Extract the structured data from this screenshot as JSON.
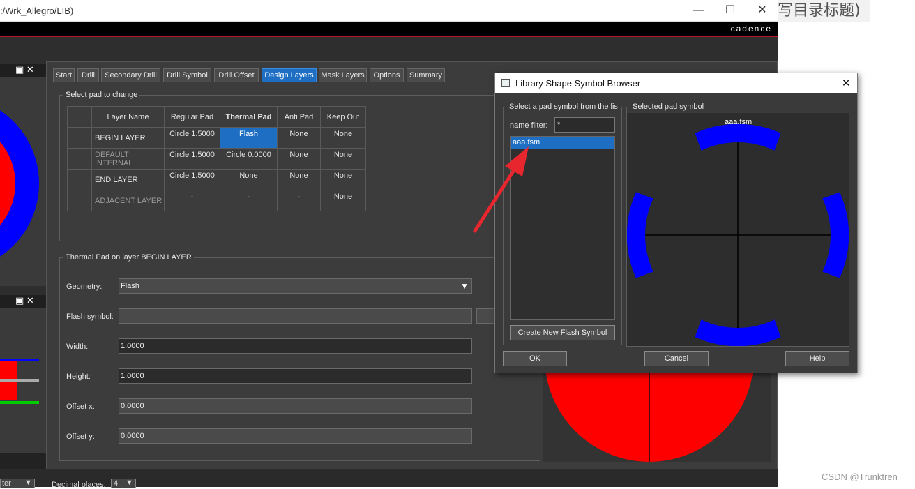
{
  "window": {
    "path": ":/Wrk_Allegro/LIB)",
    "minimize": "—",
    "maximize": "☐",
    "close": "✕",
    "brand": "cadence"
  },
  "blog": {
    "heading_fragment": "写目录标题)",
    "watermark": "CSDN @Trunktren"
  },
  "left_panel": {
    "panel1_buttons": "▣ ✕",
    "panel2_buttons": "▣ ✕"
  },
  "tabs": [
    "Start",
    "Drill",
    "Secondary Drill",
    "Drill Symbol",
    "Drill Offset",
    "Design Layers",
    "Mask Layers",
    "Options",
    "Summary"
  ],
  "active_tab": "Design Layers",
  "select_pad": {
    "group_title": "Select pad to change",
    "columns": [
      "Layer Name",
      "Regular Pad",
      "Thermal Pad",
      "Anti Pad",
      "Keep Out"
    ],
    "rows": [
      {
        "layer": "BEGIN LAYER",
        "regular": "Circle 1.5000",
        "thermal": "Flash",
        "anti": "None",
        "keepout": "None"
      },
      {
        "layer": "DEFAULT INTERNAL",
        "regular": "Circle 1.5000",
        "thermal": "Circle 0.0000",
        "anti": "None",
        "keepout": "None"
      },
      {
        "layer": "END LAYER",
        "regular": "Circle 1.5000",
        "thermal": "None",
        "anti": "None",
        "keepout": "None"
      },
      {
        "layer": "ADJACENT LAYER",
        "regular": "-",
        "thermal": "-",
        "anti": "-",
        "keepout": "None"
      }
    ]
  },
  "thermal": {
    "group_title": "Thermal Pad on layer BEGIN LAYER",
    "geometry_label": "Geometry:",
    "geometry_value": "Flash",
    "flash_label": "Flash symbol:",
    "flash_value": "",
    "width_label": "Width:",
    "width_value": "1.0000",
    "height_label": "Height:",
    "height_value": "1.0000",
    "offx_label": "Offset x:",
    "offx_value": "0.0000",
    "offy_label": "Offset y:",
    "offy_value": "0.0000"
  },
  "bottom": {
    "left_select": "ter",
    "decimal_label": "Decimal places:",
    "decimal_value": "4"
  },
  "library": {
    "title": "Library Shape Symbol Browser",
    "close": "✕",
    "list_group": "Select a pad symbol from the lis",
    "filter_label": "name filter:",
    "filter_value": "*",
    "items": [
      "aaa.fsm"
    ],
    "create_button": "Create New Flash  Symbol",
    "preview_group": "Selected pad symbol",
    "preview_name": "aaa.fsm",
    "ok": "OK",
    "cancel": "Cancel",
    "help": "Help"
  },
  "colors": {
    "pad_blue": "#0000ff",
    "pad_red": "#ff0000",
    "selection": "#1e6fc4",
    "arrow": "#e8262e"
  }
}
